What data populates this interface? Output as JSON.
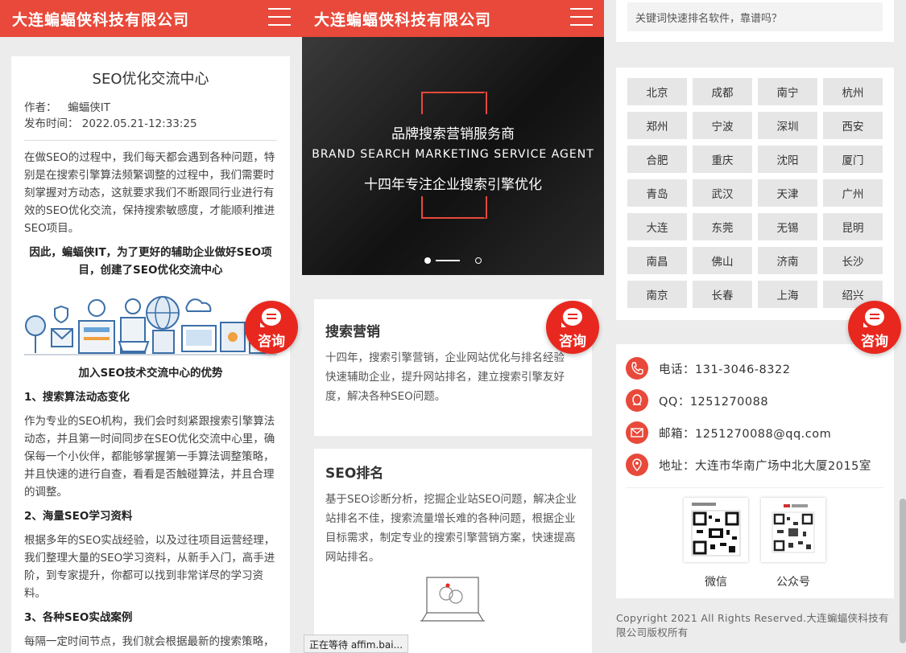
{
  "company": "大连蝙蝠侠科技有限公司",
  "consult_label": "咨询",
  "article": {
    "title": "SEO优化交流中心",
    "author_key": "作者：",
    "author": "蝙蝠侠IT",
    "date_key": "发布时间：",
    "date": "2022.05.21-12:33:25",
    "intro": "在做SEO的过程中，我们每天都会遇到各种问题，特别是在搜索引擎算法频繁调整的过程中，我们需要时刻掌握对方动态，这就要求我们不断跟同行业进行有效的SEO优化交流，保持搜索敏感度，才能顺利推进SEO项目。",
    "highlight": "因此，蝙蝠侠IT，为了更好的辅助企业做好SEO项目，创建了SEO优化交流中心",
    "adv_title": "加入SEO技术交流中心的优势",
    "h1": "1、搜索算法动态变化",
    "p1": "作为专业的SEO机构，我们会时刻紧跟搜索引擎算法动态，并且第一时间同步在SEO优化交流中心里，确保每一个小伙伴，都能够掌握第一手算法调整策略，并且快速的进行自查，看看是否触碰算法，并且合理的调整。",
    "h2": "2、海量SEO学习资料",
    "p2": "根据多年的SEO实战经验，以及过往项目运营经理，我们整理大量的SEO学习资料，从新手入门，高手进阶，到专家提升，你都可以找到非常详尽的学习资料。",
    "h3": "3、各种SEO实战案例",
    "p3": "每隔一定时间节点，我们就会根据最新的搜索策略，推送不同行业以及不同类型网站的实战案"
  },
  "banner": {
    "line1": "品牌搜索营销服务商",
    "line2": "BRAND SEARCH MARKETING SERVICE AGENT",
    "line3": "十四年专注企业搜索引擎优化"
  },
  "services": [
    {
      "title": "搜索营销",
      "text": "十四年，搜索引擎营销，企业网站优化与排名经验",
      "text2": "快速辅助企业，提升网站排名，建立搜索引擎友好度，解决各种SEO问题。"
    },
    {
      "title": "SEO排名",
      "text": "基于SEO诊断分析，挖掘企业站SEO问题，解决企业站排名不佳，搜索流量增长难的各种问题，根据企业目标需求，制定专业的搜索引擎营销方案，快速提高网站排名。",
      "text2": ""
    }
  ],
  "status_text": "正在等待 affim.bai...",
  "search": {
    "value": "关键词快速排名软件，靠谱吗？"
  },
  "cities": [
    "北京",
    "成都",
    "南宁",
    "杭州",
    "郑州",
    "宁波",
    "深圳",
    "西安",
    "合肥",
    "重庆",
    "沈阳",
    "厦门",
    "青岛",
    "武汉",
    "天津",
    "广州",
    "大连",
    "东莞",
    "无锡",
    "昆明",
    "南昌",
    "佛山",
    "济南",
    "长沙",
    "南京",
    "长春",
    "上海",
    "绍兴"
  ],
  "contact": {
    "phone": "电话：131-3046-8322",
    "qq": "QQ：1251270088",
    "email": "邮箱：1251270088@qq.com",
    "address": "地址：大连市华南广场中北大厦2015室",
    "qr1": "微信",
    "qr2": "公众号"
  },
  "footer": "Copyright 2021 All Rights Reserved.大连蝙蝠侠科技有限公司版权所有",
  "colors": {
    "brand": "#e8493a",
    "consult": "#e8281f"
  }
}
